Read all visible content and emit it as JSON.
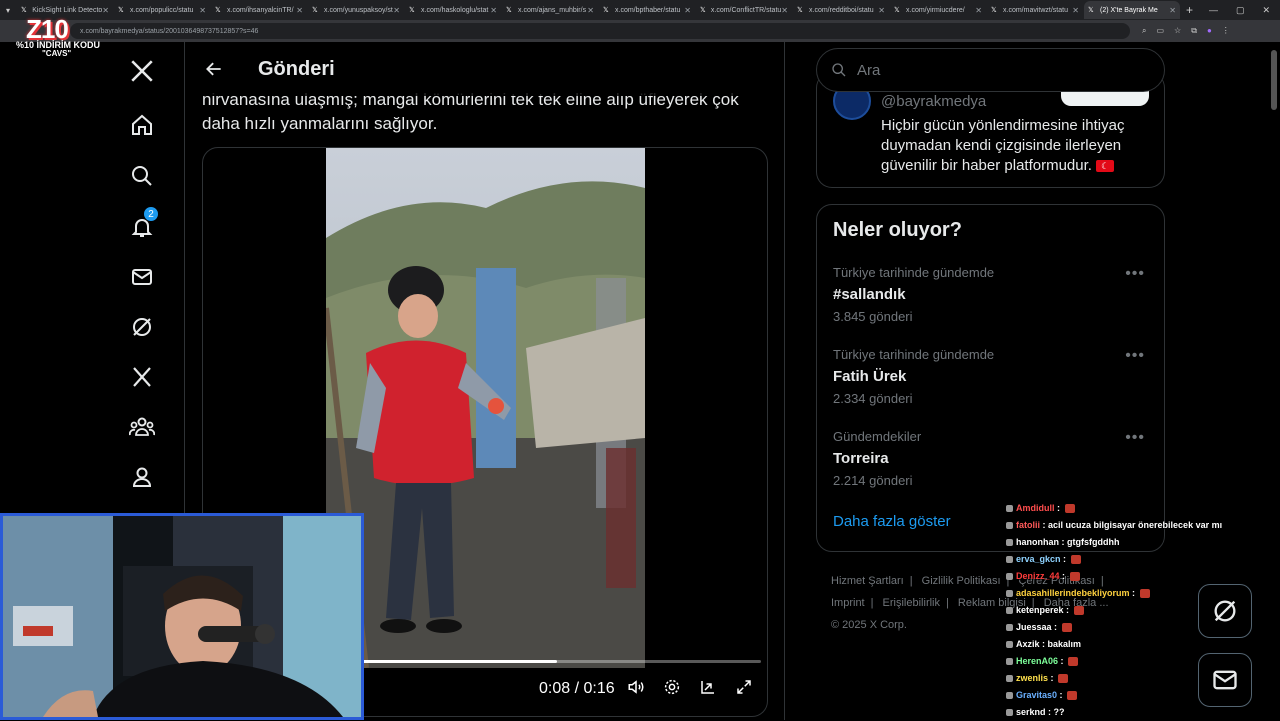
{
  "browser": {
    "tabs": [
      {
        "label": "KickSight Link Detecto",
        "active": false
      },
      {
        "label": "x.com/populicc/statu",
        "active": false
      },
      {
        "label": "x.com/ihsanyalcinTR/",
        "active": false
      },
      {
        "label": "x.com/yunuspaksoy/st",
        "active": false
      },
      {
        "label": "x.com/haskologlu/stat",
        "active": false
      },
      {
        "label": "x.com/ajans_muhbir/s",
        "active": false
      },
      {
        "label": "x.com/bpthaber/statu",
        "active": false
      },
      {
        "label": "x.com/ConflictTR/statu",
        "active": false
      },
      {
        "label": "x.com/redditboi/statu",
        "active": false
      },
      {
        "label": "x.com/yirmiucdere/",
        "active": false
      },
      {
        "label": "x.com/mavitwzt/statu",
        "active": false
      },
      {
        "label": "(2) X'te Bayrak Me",
        "active": true
      }
    ],
    "url": "x.com/bayrakmedya/status/2001036498737512857?s=46"
  },
  "overlay": {
    "logo": "Z10",
    "promo": "%10 İNDİRİM KODU",
    "code": "\"CAVS\""
  },
  "nav": {
    "notifications_badge": "2"
  },
  "main": {
    "title": "Gönderi",
    "post_text": "nirvanasına ulaşmış; mangal kömürlerini tek tek eline alıp üfleyerek çok daha hızlı yanmalarını sağlıyor.",
    "video": {
      "time": "0:08 / 0:16",
      "progress": 0.5
    }
  },
  "sidebar": {
    "search_placeholder": "Ara",
    "profile": {
      "handle": "@bayrakmedya",
      "bio": "Hiçbir gücün yönlendirmesine ihtiyaç duymadan kendi çizgisinde ilerleyen güvenilir bir haber platformudur.",
      "flag": "🇹🇷"
    },
    "trends_title": "Neler oluyor?",
    "trends": [
      {
        "context": "Türkiye tarihinde gündemde",
        "name": "#sallandık",
        "count": "3.845 gönderi"
      },
      {
        "context": "Türkiye tarihinde gündemde",
        "name": "Fatih Ürek",
        "count": "2.334 gönderi"
      },
      {
        "context": "Gündemdekiler",
        "name": "Torreira",
        "count": "2.214 gönderi"
      }
    ],
    "show_more": "Daha fazla göster",
    "footer": [
      "Hizmet Şartları",
      "Gizlilik Politikası",
      "Çerez Politikası",
      "Imprint",
      "Erişilebilirlik",
      "Reklam bilgisi",
      "Daha fazla ...",
      "© 2025 X Corp."
    ]
  },
  "chat": [
    {
      "user": "Amdidull",
      "msg": "",
      "color": "#ff4d4d"
    },
    {
      "user": "fatolii",
      "msg": "acil ucuza bilgisayar önerebilecek var mı",
      "color": "#ff5a5a"
    },
    {
      "user": "hanonhan",
      "msg": "gtgfsfgddhh",
      "color": "#ffffff"
    },
    {
      "user": "erva_gkcn",
      "msg": "",
      "color": "#8fd3ff"
    },
    {
      "user": "Denizz_44",
      "msg": "",
      "color": "#ff3b3b"
    },
    {
      "user": "adasahillerindebekliyorum",
      "msg": "",
      "color": "#ffd23f"
    },
    {
      "user": "ketenperek",
      "msg": "",
      "color": "#ffffff"
    },
    {
      "user": "Juessaa",
      "msg": "",
      "color": "#ffffff"
    },
    {
      "user": "Axzik",
      "msg": "bakalım",
      "color": "#ffffff"
    },
    {
      "user": "HerenA06",
      "msg": "",
      "color": "#7dff9a"
    },
    {
      "user": "zwenlis",
      "msg": "",
      "color": "#ffe14d"
    },
    {
      "user": "Gravitas0",
      "msg": "",
      "color": "#6ab0ff"
    },
    {
      "user": "serknd",
      "msg": "??",
      "color": "#ffffff"
    }
  ],
  "colors": {
    "accent": "#1d9bf0",
    "webcam_border": "#2b5bd7"
  }
}
